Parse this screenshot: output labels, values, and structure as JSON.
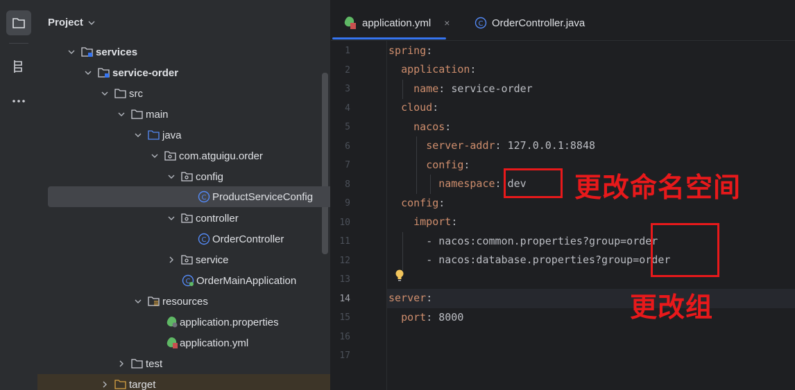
{
  "project_panel": {
    "title": "Project",
    "tree": [
      {
        "label": "services",
        "level": 0
      },
      {
        "label": "service-order",
        "level": 1
      },
      {
        "label": "src",
        "level": 2
      },
      {
        "label": "main",
        "level": 3
      },
      {
        "label": "java",
        "level": 4
      },
      {
        "label": "com.atguigu.order",
        "level": 5
      },
      {
        "label": "config",
        "level": 6
      },
      {
        "label": "ProductServiceConfig",
        "level": 7
      },
      {
        "label": "controller",
        "level": 6
      },
      {
        "label": "OrderController",
        "level": 7
      },
      {
        "label": "service",
        "level": 6
      },
      {
        "label": "OrderMainApplication",
        "level": 6
      },
      {
        "label": "resources",
        "level": 4
      },
      {
        "label": "application.properties",
        "level": 5
      },
      {
        "label": "application.yml",
        "level": 5
      },
      {
        "label": "test",
        "level": 3
      },
      {
        "label": "target",
        "level": 2
      }
    ]
  },
  "editor": {
    "tabs": [
      {
        "label": "application.yml",
        "close": "×"
      },
      {
        "label": "OrderController.java"
      }
    ],
    "line_numbers": [
      "1",
      "2",
      "3",
      "4",
      "5",
      "6",
      "7",
      "8",
      "9",
      "10",
      "11",
      "12",
      "13",
      "14",
      "15",
      "16",
      "17"
    ],
    "current_line": "14",
    "code": {
      "l1_key": "spring",
      "l2_key": "application",
      "l3_key": "name",
      "l3_val": "service-order",
      "l4_key": "cloud",
      "l5_key": "nacos",
      "l6_key": "server-addr",
      "l6_val": "127.0.0.1:8848",
      "l7_key": "config",
      "l8_key": "namespace",
      "l8_val": "dev",
      "l9_key": "config",
      "l10_key": "import",
      "l11_val": "- nacos:common.properties?group=order",
      "l12_val": "- nacos:database.properties?group=order",
      "l14_key": "server",
      "l15_key": "port",
      "l15_val": "8000",
      "colon": ":"
    }
  },
  "annotations": {
    "namespace_note": "更改命名空间",
    "group_note": "更改组",
    "color": "#e8191b"
  }
}
